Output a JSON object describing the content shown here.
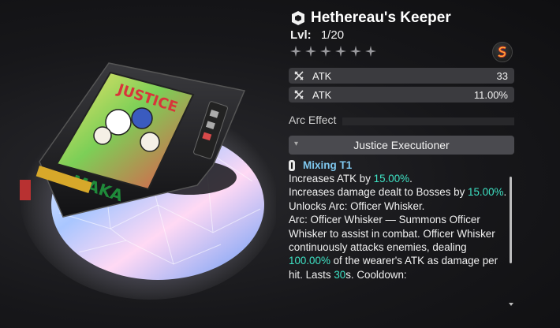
{
  "item": {
    "name": "Hethereau's Keeper",
    "level_label": "Lvl:",
    "level_value": "1/20",
    "stars_total": 6,
    "stars_filled": 0,
    "brand_icon": "s-brand-icon"
  },
  "stats": [
    {
      "icon": "atk-crossed-swords-icon",
      "name": "ATK",
      "value": "33"
    },
    {
      "icon": "atk-crossed-swords-icon",
      "name": "ATK",
      "value": "11.00%"
    }
  ],
  "arc": {
    "label": "Arc Effect",
    "selected": "Justice Executioner"
  },
  "mixing": {
    "tier_label": "Mixing T1",
    "lines": [
      [
        {
          "t": "Increases ATK by "
        },
        {
          "t": "15.00%",
          "hl": true
        },
        {
          "t": "."
        }
      ],
      [
        {
          "t": "Increases damage dealt to Bosses by "
        },
        {
          "t": "15.00%",
          "hl": true
        },
        {
          "t": "."
        }
      ],
      [
        {
          "t": "Unlocks Arc: Officer Whisker."
        }
      ],
      [
        {
          "t": "Arc: Officer Whisker — Summons Officer Whisker to assist in combat. Officer Whisker continuously attacks enemies, dealing "
        },
        {
          "t": "100.00%",
          "hl": true
        },
        {
          "t": " of the wearer's ATK as damage per hit. Lasts "
        },
        {
          "t": "30",
          "hl": true
        },
        {
          "t": "s. Cooldown:"
        }
      ]
    ]
  },
  "art": {
    "cover_text_top": "JUSTICE",
    "cover_text_bottom": "MAKA"
  },
  "colors": {
    "highlight": "#3ee2c4",
    "tier_name": "#7fc8ef",
    "stat_bg": "#3b3b3f"
  }
}
